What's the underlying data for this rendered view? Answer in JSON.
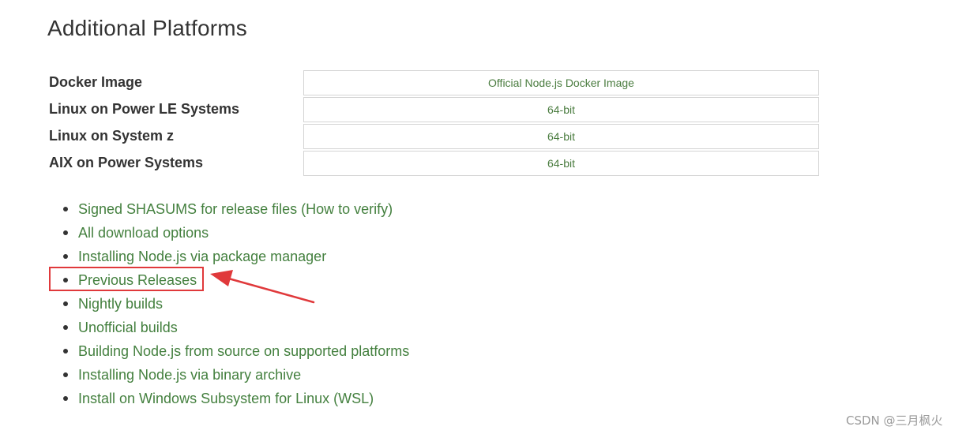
{
  "page": {
    "title": "Additional Platforms"
  },
  "platforms": [
    {
      "name": "Docker Image",
      "link": "Official Node.js Docker Image"
    },
    {
      "name": "Linux on Power LE Systems",
      "link": "64-bit"
    },
    {
      "name": "Linux on System z",
      "link": "64-bit"
    },
    {
      "name": "AIX on Power Systems",
      "link": "64-bit"
    }
  ],
  "links": [
    {
      "text": "Signed SHASUMS for release files (How to verify)"
    },
    {
      "text": "All download options"
    },
    {
      "text": "Installing Node.js via package manager"
    },
    {
      "text": "Previous Releases"
    },
    {
      "text": "Nightly builds"
    },
    {
      "text": "Unofficial builds"
    },
    {
      "text": "Building Node.js from source on supported platforms"
    },
    {
      "text": "Installing Node.js via binary archive"
    },
    {
      "text": "Install on Windows Subsystem for Linux (WSL)"
    }
  ],
  "annotation": {
    "highlighted_item": "Previous Releases",
    "color": "#e0393b"
  },
  "watermark": "CSDN @三月枫火",
  "colors": {
    "link": "#44803f",
    "text": "#333333",
    "border": "#d4d4d4",
    "annotation": "#e0393b"
  }
}
